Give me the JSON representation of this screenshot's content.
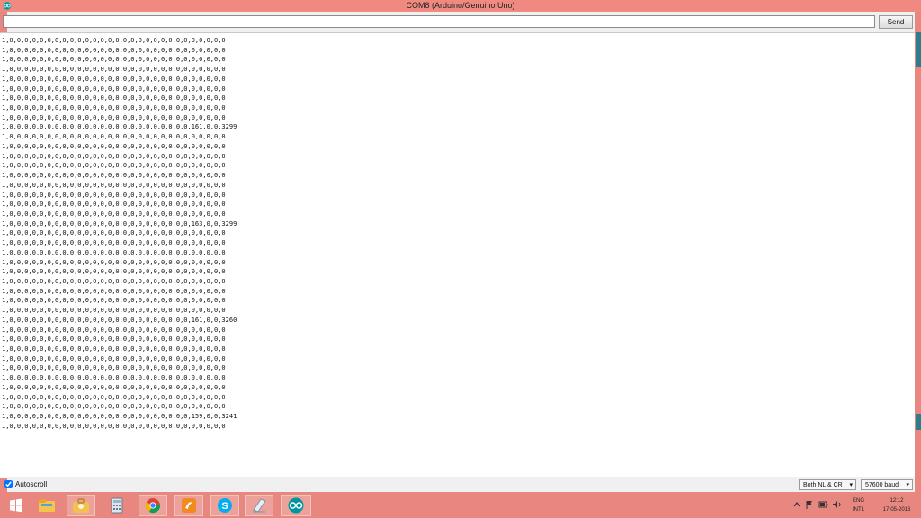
{
  "window": {
    "title": "COM8 (Arduino/Genuino Uno)"
  },
  "input": {
    "value": "",
    "send_label": "Send"
  },
  "output": {
    "lines": [
      "1,0,0,0,0,0,0,0,0,0,0,0,0,0,0,0,0,0,0,0,0,0,0,0,0,0,0,0,0,0",
      "1,0,0,0,0,0,0,0,0,0,0,0,0,0,0,0,0,0,0,0,0,0,0,0,0,0,0,0,0,0",
      "1,0,0,0,0,0,0,0,0,0,0,0,0,0,0,0,0,0,0,0,0,0,0,0,0,0,0,0,0,0",
      "1,0,0,0,0,0,0,0,0,0,0,0,0,0,0,0,0,0,0,0,0,0,0,0,0,0,0,0,0,0",
      "1,0,0,0,0,0,0,0,0,0,0,0,0,0,0,0,0,0,0,0,0,0,0,0,0,0,0,0,0,0",
      "1,0,0,0,0,0,0,0,0,0,0,0,0,0,0,0,0,0,0,0,0,0,0,0,0,0,0,0,0,0",
      "1,0,0,0,0,0,0,0,0,0,0,0,0,0,0,0,0,0,0,0,0,0,0,0,0,0,0,0,0,0",
      "1,0,0,0,0,0,0,0,0,0,0,0,0,0,0,0,0,0,0,0,0,0,0,0,0,0,0,0,0,0",
      "1,0,0,0,0,0,0,0,0,0,0,0,0,0,0,0,0,0,0,0,0,0,0,0,0,0,0,0,0,0",
      "1,0,0,0,0,0,0,0,0,0,0,0,0,0,0,0,0,0,0,0,0,0,0,0,0,161,0,0,3299",
      "1,0,0,0,0,0,0,0,0,0,0,0,0,0,0,0,0,0,0,0,0,0,0,0,0,0,0,0,0,0",
      "1,0,0,0,0,0,0,0,0,0,0,0,0,0,0,0,0,0,0,0,0,0,0,0,0,0,0,0,0,0",
      "1,0,0,0,0,0,0,0,0,0,0,0,0,0,0,0,0,0,0,0,0,0,0,0,0,0,0,0,0,0",
      "1,0,0,0,0,0,0,0,0,0,0,0,0,0,0,0,0,0,0,0,0,0,0,0,0,0,0,0,0,0",
      "1,0,0,0,0,0,0,0,0,0,0,0,0,0,0,0,0,0,0,0,0,0,0,0,0,0,0,0,0,0",
      "1,0,0,0,0,0,0,0,0,0,0,0,0,0,0,0,0,0,0,0,0,0,0,0,0,0,0,0,0,0",
      "1,0,0,0,0,0,0,0,0,0,0,0,0,0,0,0,0,0,0,0,0,0,0,0,0,0,0,0,0,0",
      "1,0,0,0,0,0,0,0,0,0,0,0,0,0,0,0,0,0,0,0,0,0,0,0,0,0,0,0,0,0",
      "1,0,0,0,0,0,0,0,0,0,0,0,0,0,0,0,0,0,0,0,0,0,0,0,0,0,0,0,0,0",
      "1,0,0,0,0,0,0,0,0,0,0,0,0,0,0,0,0,0,0,0,0,0,0,0,0,163,0,0,3299",
      "1,0,0,0,0,0,0,0,0,0,0,0,0,0,0,0,0,0,0,0,0,0,0,0,0,0,0,0,0,0",
      "1,0,0,0,0,0,0,0,0,0,0,0,0,0,0,0,0,0,0,0,0,0,0,0,0,0,0,0,0,0",
      "1,0,0,0,0,0,0,0,0,0,0,0,0,0,0,0,0,0,0,0,0,0,0,0,0,0,0,0,0,0",
      "1,0,0,0,0,0,0,0,0,0,0,0,0,0,0,0,0,0,0,0,0,0,0,0,0,0,0,0,0,0",
      "1,0,0,0,0,0,0,0,0,0,0,0,0,0,0,0,0,0,0,0,0,0,0,0,0,0,0,0,0,0",
      "1,0,0,0,0,0,0,0,0,0,0,0,0,0,0,0,0,0,0,0,0,0,0,0,0,0,0,0,0,0",
      "1,0,0,0,0,0,0,0,0,0,0,0,0,0,0,0,0,0,0,0,0,0,0,0,0,0,0,0,0,0",
      "1,0,0,0,0,0,0,0,0,0,0,0,0,0,0,0,0,0,0,0,0,0,0,0,0,0,0,0,0,0",
      "1,0,0,0,0,0,0,0,0,0,0,0,0,0,0,0,0,0,0,0,0,0,0,0,0,0,0,0,0,0",
      "1,0,0,0,0,0,0,0,0,0,0,0,0,0,0,0,0,0,0,0,0,0,0,0,0,161,0,0,3260",
      "1,0,0,0,0,0,0,0,0,0,0,0,0,0,0,0,0,0,0,0,0,0,0,0,0,0,0,0,0,0",
      "1,0,0,0,0,0,0,0,0,0,0,0,0,0,0,0,0,0,0,0,0,0,0,0,0,0,0,0,0,0",
      "1,0,0,0,0,0,0,0,0,0,0,0,0,0,0,0,0,0,0,0,0,0,0,0,0,0,0,0,0,0",
      "1,0,0,0,0,0,0,0,0,0,0,0,0,0,0,0,0,0,0,0,0,0,0,0,0,0,0,0,0,0",
      "1,0,0,0,0,0,0,0,0,0,0,0,0,0,0,0,0,0,0,0,0,0,0,0,0,0,0,0,0,0",
      "1,0,0,0,0,0,0,0,0,0,0,0,0,0,0,0,0,0,0,0,0,0,0,0,0,0,0,0,0,0",
      "1,0,0,0,0,0,0,0,0,0,0,0,0,0,0,0,0,0,0,0,0,0,0,0,0,0,0,0,0,0",
      "1,0,0,0,0,0,0,0,0,0,0,0,0,0,0,0,0,0,0,0,0,0,0,0,0,0,0,0,0,0",
      "1,0,0,0,0,0,0,0,0,0,0,0,0,0,0,0,0,0,0,0,0,0,0,0,0,0,0,0,0,0",
      "1,0,0,0,0,0,0,0,0,0,0,0,0,0,0,0,0,0,0,0,0,0,0,0,0,159,0,0,3241",
      "1,0,0,0,0,0,0,0,0,0,0,0,0,0,0,0,0,0,0,0,0,0,0,0,0,0,0,0,0,0"
    ]
  },
  "status": {
    "autoscroll_label": "Autoscroll",
    "autoscroll_checked": true,
    "line_ending": "Both NL & CR",
    "baud_rate": "57600 baud"
  },
  "taskbar": {
    "icons": [
      "windows-start-icon",
      "file-explorer-icon",
      "briefcase-icon",
      "calculator-icon",
      "chrome-icon",
      "foxit-reader-icon",
      "skype-icon",
      "notepad-icon",
      "arduino-icon"
    ],
    "language_top": "ENG",
    "language_bottom": "INTL",
    "time": "12:12",
    "date": "17-05-2016"
  },
  "colors": {
    "titlebar": "#f08a80",
    "taskbar": "#e8877f",
    "window_bg": "#f0f0f0",
    "arduino_teal": "#00979c"
  }
}
